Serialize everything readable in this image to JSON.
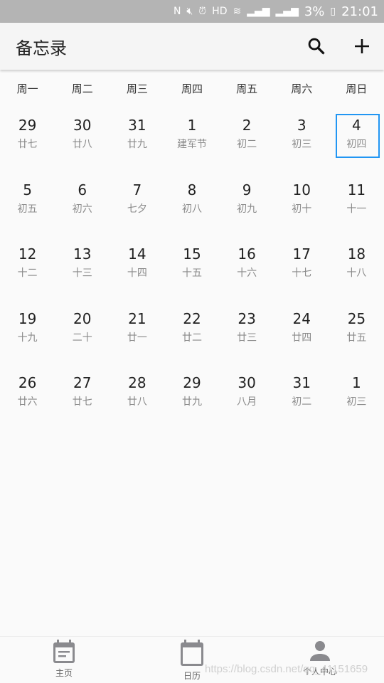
{
  "status_bar": {
    "icons": [
      "nfc-icon",
      "mute-icon",
      "alarm-icon",
      "hd-icon",
      "wifi-icon",
      "signal-4g-icon",
      "signal-e-icon"
    ],
    "battery": "3%",
    "time": "21:01"
  },
  "header": {
    "title": "备忘录",
    "search_icon": "search-icon",
    "add_icon": "plus-icon"
  },
  "weekdays": [
    "周一",
    "周二",
    "周三",
    "周四",
    "周五",
    "周六",
    "周日"
  ],
  "calendar": {
    "selected_index": 6,
    "accent": "#2196f3",
    "days": [
      {
        "d": "29",
        "l": "廿七"
      },
      {
        "d": "30",
        "l": "廿八"
      },
      {
        "d": "31",
        "l": "廿九"
      },
      {
        "d": "1",
        "l": "建军节"
      },
      {
        "d": "2",
        "l": "初二"
      },
      {
        "d": "3",
        "l": "初三"
      },
      {
        "d": "4",
        "l": "初四"
      },
      {
        "d": "5",
        "l": "初五"
      },
      {
        "d": "6",
        "l": "初六"
      },
      {
        "d": "7",
        "l": "七夕"
      },
      {
        "d": "8",
        "l": "初八"
      },
      {
        "d": "9",
        "l": "初九"
      },
      {
        "d": "10",
        "l": "初十"
      },
      {
        "d": "11",
        "l": "十一"
      },
      {
        "d": "12",
        "l": "十二"
      },
      {
        "d": "13",
        "l": "十三"
      },
      {
        "d": "14",
        "l": "十四"
      },
      {
        "d": "15",
        "l": "十五"
      },
      {
        "d": "16",
        "l": "十六"
      },
      {
        "d": "17",
        "l": "十七"
      },
      {
        "d": "18",
        "l": "十八"
      },
      {
        "d": "19",
        "l": "十九"
      },
      {
        "d": "20",
        "l": "二十"
      },
      {
        "d": "21",
        "l": "廿一"
      },
      {
        "d": "22",
        "l": "廿二"
      },
      {
        "d": "23",
        "l": "廿三"
      },
      {
        "d": "24",
        "l": "廿四"
      },
      {
        "d": "25",
        "l": "廿五"
      },
      {
        "d": "26",
        "l": "廿六"
      },
      {
        "d": "27",
        "l": "廿七"
      },
      {
        "d": "28",
        "l": "廿八"
      },
      {
        "d": "29",
        "l": "廿九"
      },
      {
        "d": "30",
        "l": "八月"
      },
      {
        "d": "31",
        "l": "初二"
      },
      {
        "d": "1",
        "l": "初三"
      }
    ]
  },
  "nav": {
    "items": [
      {
        "label": "主页",
        "icon": "calendar-note-icon"
      },
      {
        "label": "日历",
        "icon": "calendar-icon"
      },
      {
        "label": "个人中心",
        "icon": "person-icon"
      }
    ]
  },
  "watermark": "https://blog.csdn.net/qq_41151659"
}
